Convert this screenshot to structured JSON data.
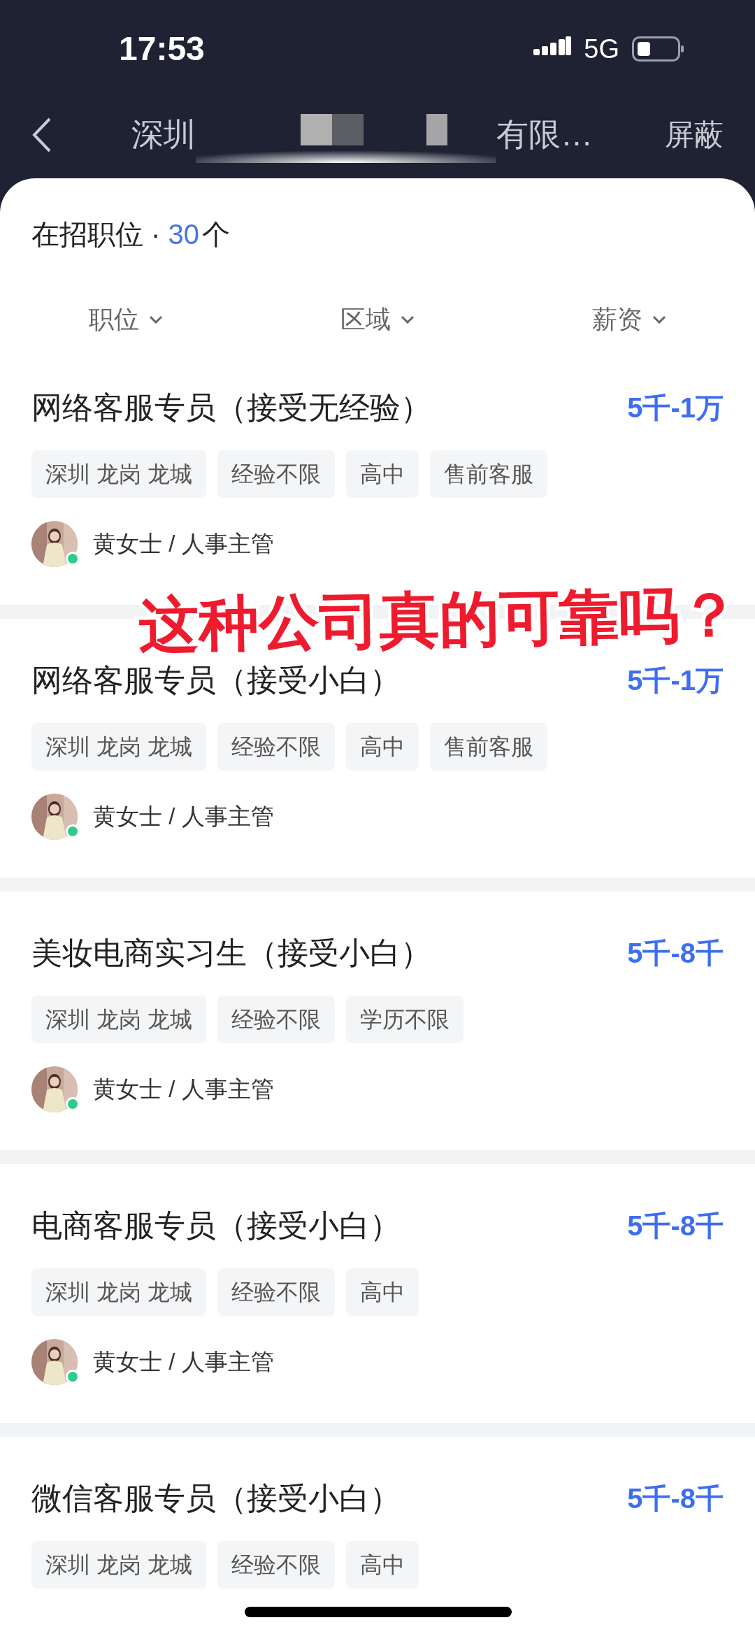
{
  "status_bar": {
    "time": "17:53",
    "network": "5G"
  },
  "nav": {
    "title_start": "深圳",
    "title_end": "有限…",
    "action": "屏蔽"
  },
  "summary": {
    "label": "在招职位 · ",
    "count": "30",
    "unit": "个"
  },
  "filters": [
    "职位",
    "区域",
    "薪资"
  ],
  "jobs": [
    {
      "title": "网络客服专员（接受无经验）",
      "salary": "5千-1万",
      "tags": [
        "深圳 龙岗 龙城",
        "经验不限",
        "高中",
        "售前客服"
      ],
      "contact": {
        "text": "黄女士 / 人事主管",
        "online": true
      }
    },
    {
      "title": "网络客服专员（接受小白）",
      "salary": "5千-1万",
      "tags": [
        "深圳 龙岗 龙城",
        "经验不限",
        "高中",
        "售前客服"
      ],
      "contact": {
        "text": "黄女士 / 人事主管",
        "online": true
      }
    },
    {
      "title": "美妆电商实习生（接受小白）",
      "salary": "5千-8千",
      "tags": [
        "深圳 龙岗 龙城",
        "经验不限",
        "学历不限"
      ],
      "contact": {
        "text": "黄女士 / 人事主管",
        "online": true
      }
    },
    {
      "title": "电商客服专员（接受小白）",
      "salary": "5千-8千",
      "tags": [
        "深圳 龙岗 龙城",
        "经验不限",
        "高中"
      ],
      "contact": {
        "text": "黄女士 / 人事主管",
        "online": true
      }
    },
    {
      "title": "微信客服专员（接受小白）",
      "salary": "5千-8千",
      "tags": [
        "深圳 龙岗 龙城",
        "经验不限",
        "高中"
      ]
    }
  ],
  "caption": "这种公司真的可靠吗？"
}
